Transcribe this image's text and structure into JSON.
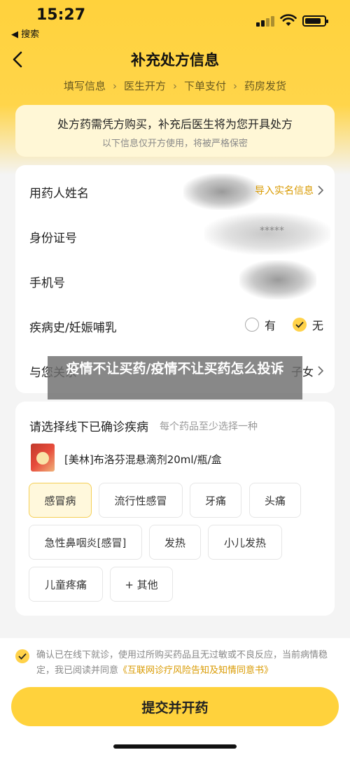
{
  "status": {
    "time": "15:27",
    "back_app": "◀ 搜索"
  },
  "nav": {
    "title": "补充处方信息"
  },
  "steps": [
    "填写信息",
    "医生开方",
    "下单支付",
    "药房发货"
  ],
  "notice": {
    "main": "处方药需凭方购买，补充后医生将为您开具处方",
    "sub": "以下信息仅开方使用，将被严格保密"
  },
  "form": {
    "name_label": "用药人姓名",
    "import_link": "导入实名信息",
    "id_label": "身份证号",
    "id_value": "*****",
    "phone_label": "手机号",
    "history_label": "疾病史/妊娠哺乳",
    "history_yes": "有",
    "history_no": "无",
    "relation_label": "与您关系",
    "relation_value": "子女"
  },
  "banner": {
    "text": "疫情不让买药/疫情不让买药怎么投诉"
  },
  "disease": {
    "title": "请选择线下已确诊疾病",
    "hint": "每个药品至少选择一种",
    "drug_name": "[美林]布洛芬混悬滴剂20ml/瓶/盒",
    "tags": [
      "感冒病",
      "流行性感冒",
      "牙痛",
      "头痛",
      "急性鼻咽炎[感冒]",
      "发热",
      "小儿发热",
      "儿童疼痛",
      "+ 其他"
    ],
    "selected": "感冒病"
  },
  "agreement": {
    "text": "确认已在线下就诊，使用过所购买药品且无过敏或不良反应，当前病情稳定，我已阅读并同意",
    "link": "《互联网诊疗风险告知及知情同意书》"
  },
  "submit_label": "提交并开药",
  "colors": {
    "brand_yellow": "#ffd23c",
    "link": "#d99a00"
  }
}
